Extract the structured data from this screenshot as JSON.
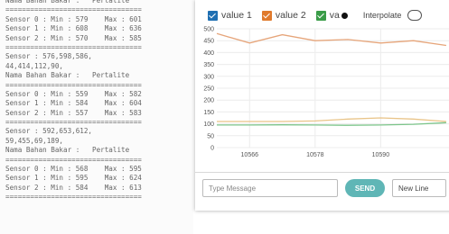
{
  "serial_monitor": {
    "lines": [
      "Nama Bahan Bakar :   Pertalite",
      "=================================",
      "Sensor 0 : Min : 579    Max : 601",
      "Sensor 1 : Min : 608    Max : 636",
      "Sensor 2 : Min : 570    Max : 585",
      "=================================",
      "Sensor : 576,598,586,",
      "44,414,112,90,",
      "Nama Bahan Bakar :   Pertalite",
      "=================================",
      "Sensor 0 : Min : 559    Max : 582",
      "Sensor 1 : Min : 584    Max : 604",
      "Sensor 2 : Min : 557    Max : 583",
      "=================================",
      "Sensor : 592,653,612,",
      "59,455,69,189,",
      "Nama Bahan Bakar :   Pertalite",
      "=================================",
      "Sensor 0 : Min : 568    Max : 595",
      "Sensor 1 : Min : 595    Max : 624",
      "Sensor 2 : Min : 584    Max : 613",
      "================================="
    ]
  },
  "plotter": {
    "legend": [
      {
        "label": "value 1",
        "color": "#1f6fb2"
      },
      {
        "label": "value 2",
        "color": "#e07a2c"
      },
      {
        "label": "va",
        "color": "#3a9c48"
      }
    ],
    "info_icon": "info-icon",
    "interpolate_label": "Interpolate",
    "message_placeholder": "Type Message",
    "send_label": "SEND",
    "line_ending": "New Line"
  },
  "chart_data": {
    "type": "line",
    "x": [
      10560,
      10566,
      10572,
      10578,
      10584,
      10590,
      10596,
      10602
    ],
    "x_ticks": [
      10566,
      10578,
      10590
    ],
    "y_ticks": [
      0,
      50,
      100,
      150,
      200,
      250,
      300,
      350,
      400,
      450,
      500
    ],
    "ylim": [
      0,
      500
    ],
    "xlim": [
      10560,
      10604
    ],
    "series": [
      {
        "name": "value 1",
        "color": "#e6a57a",
        "values": [
          480,
          440,
          475,
          450,
          455,
          440,
          450,
          430
        ]
      },
      {
        "name": "value 2",
        "color": "#e9c488",
        "values": [
          110,
          110,
          110,
          112,
          120,
          125,
          120,
          110
        ]
      },
      {
        "name": "va",
        "color": "#7cc58a",
        "values": [
          95,
          95,
          96,
          95,
          94,
          95,
          98,
          105
        ]
      }
    ]
  }
}
